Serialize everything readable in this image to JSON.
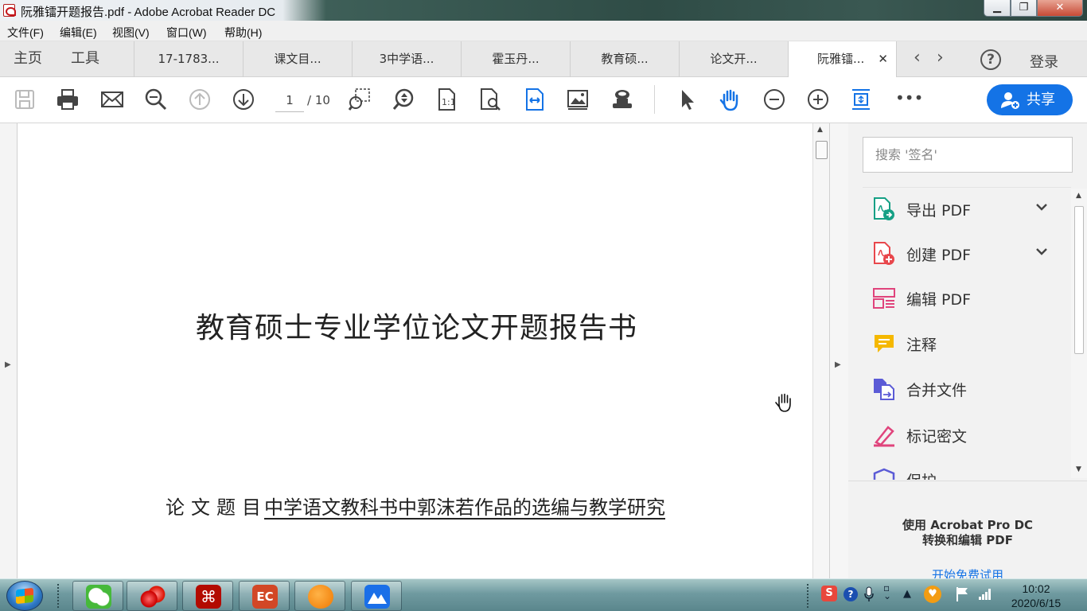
{
  "window": {
    "title": "阮雅镭开题报告.pdf - Adobe Acrobat Reader DC",
    "minimize": "▁",
    "maximize": "❐",
    "close": "✕"
  },
  "menubar": {
    "items": [
      "文件(F)",
      "编辑(E)",
      "视图(V)",
      "窗口(W)",
      "帮助(H)"
    ]
  },
  "tabs": {
    "home": "主页",
    "tools": "工具",
    "documents": [
      "17-1783...",
      "课文目...",
      "3中学语...",
      "霍玉丹...",
      "教育硕...",
      "论文开...",
      "阮雅镭..."
    ],
    "active_index": 6,
    "close_glyph": "✕",
    "prev_glyph": "‹",
    "next_glyph": "›",
    "help_glyph": "?",
    "login": "登录"
  },
  "toolbar": {
    "icons": [
      "save-icon",
      "print-icon",
      "email-icon",
      "search-zoom-icon",
      "previous-page-icon",
      "next-page-icon",
      "marquee-zoom-icon",
      "zoom-region-icon",
      "actual-size-icon",
      "find-icon",
      "fit-width-icon",
      "image-icon",
      "stamp-icon",
      "select-cursor-icon",
      "hand-tool-icon",
      "zoom-out-icon",
      "zoom-in-icon",
      "crop-icon",
      "more-icon"
    ],
    "page_current": "1",
    "page_total": "/ 10",
    "more": "•••",
    "share_label": "共享"
  },
  "document": {
    "title": "教育硕士专业学位论文开题报告书",
    "topic_label": "论文题目",
    "topic_text": "中学语文教科书中郭沫若作品的选编与教学研究"
  },
  "right_panel": {
    "search_placeholder": "搜索 '签名'",
    "tools": [
      {
        "label": "导出 PDF",
        "icon": "export-pdf-icon",
        "color": "#16a085",
        "expandable": true
      },
      {
        "label": "创建 PDF",
        "icon": "create-pdf-icon",
        "color": "#e8474c",
        "expandable": true
      },
      {
        "label": "编辑 PDF",
        "icon": "edit-pdf-icon",
        "color": "#e0447c",
        "expandable": false
      },
      {
        "label": "注释",
        "icon": "comment-icon",
        "color": "#f5b800",
        "expandable": false
      },
      {
        "label": "合并文件",
        "icon": "combine-files-icon",
        "color": "#5b5bd6",
        "expandable": false
      },
      {
        "label": "标记密文",
        "icon": "redact-icon",
        "color": "#e0447c",
        "expandable": false
      },
      {
        "label": "保护",
        "icon": "protect-icon",
        "color": "#5b5bd6",
        "expandable": false
      }
    ],
    "chevron": "⌄",
    "promo_line1": "使用 Acrobat Pro DC",
    "promo_line2": "转换和编辑 PDF",
    "promo_link": "开始免费试用"
  },
  "taskbar": {
    "apps": [
      "wechat-icon",
      "red-balls-icon",
      "acrobat-icon",
      "powerpoint-icon",
      "orange-icon",
      "blue-app-icon"
    ],
    "tray_icons": [
      "sogou-icon",
      "help-circle-icon",
      "microphone-icon",
      "keyboard-icon",
      "arrow-up-icon",
      "shield-icon",
      "flag-icon",
      "signal-icon"
    ],
    "time": "10:02",
    "date": "2020/6/15"
  },
  "colors": {
    "accent": "#1473e6",
    "active_tab": "#ffffff"
  }
}
